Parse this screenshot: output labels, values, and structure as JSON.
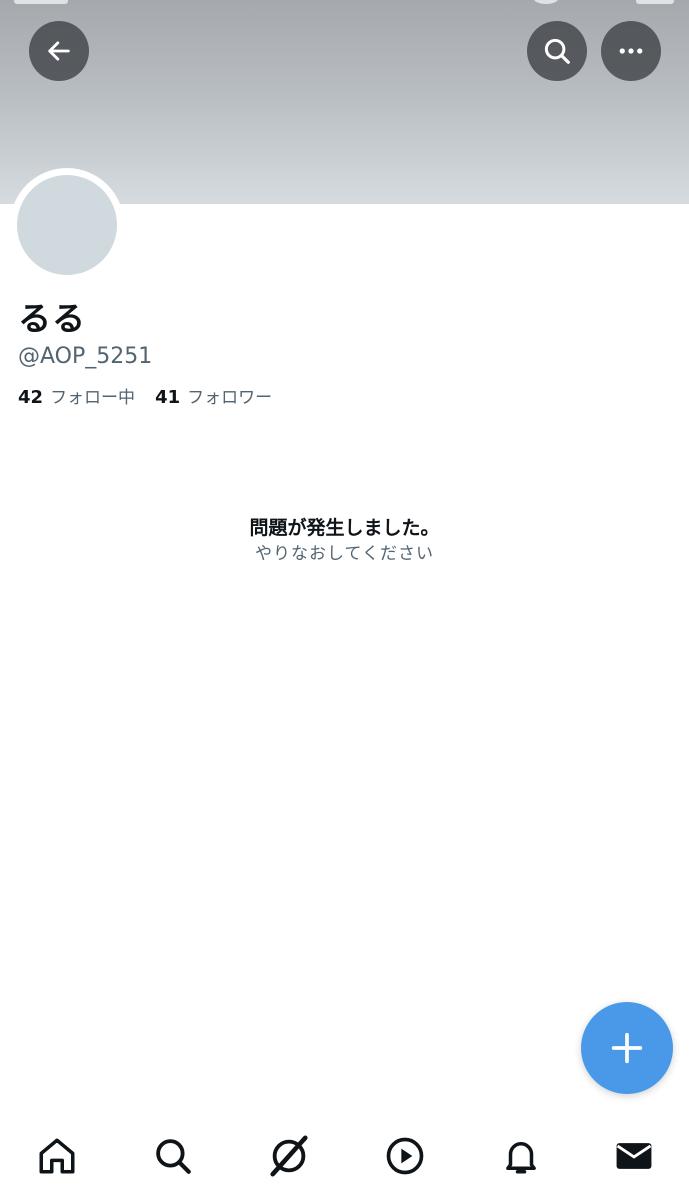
{
  "profile": {
    "display_name": "るる",
    "handle": "@AOP_5251",
    "following_count": "42",
    "following_label": "フォロー中",
    "followers_count": "41",
    "followers_label": "フォロワー"
  },
  "error": {
    "title": "問題が発生しました。",
    "subtitle": "やりなおしてください"
  },
  "header": {
    "back_icon": "arrow-left-icon",
    "search_icon": "search-icon",
    "more_icon": "more-horizontal-icon"
  },
  "tabbar": {
    "items": [
      {
        "icon": "home-icon"
      },
      {
        "icon": "search-icon"
      },
      {
        "icon": "grok-slash-icon"
      },
      {
        "icon": "play-circle-icon"
      },
      {
        "icon": "bell-icon"
      },
      {
        "icon": "mail-icon"
      }
    ]
  },
  "fab": {
    "icon": "plus-icon"
  },
  "colors": {
    "accent": "#4a99e9",
    "text_primary": "#0f1419",
    "text_secondary": "#536471",
    "avatar_placeholder": "#cfd9de"
  }
}
